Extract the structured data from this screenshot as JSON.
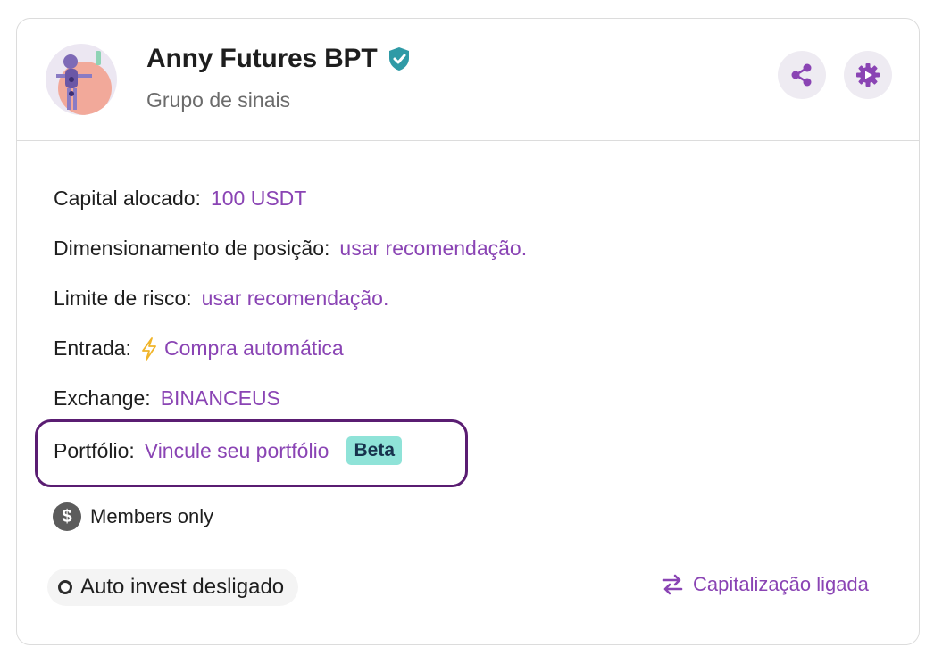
{
  "header": {
    "title": "Anny Futures BPT",
    "subtitle": "Grupo de sinais",
    "avatar_icon": "robot-avatar-icon",
    "verified_icon": "verified-shield-icon",
    "share_icon": "share-icon",
    "settings_icon": "gear-icon"
  },
  "settings": {
    "capital": {
      "label": "Capital alocado:",
      "value": "100 USDT"
    },
    "position_sizing": {
      "label": "Dimensionamento de posição:",
      "value": "usar recomendação."
    },
    "risk_limit": {
      "label": "Limite de risco:",
      "value": "usar recomendação."
    },
    "entry": {
      "label": "Entrada:",
      "icon": "lightning-bolt-icon",
      "value": "Compra automática"
    },
    "exchange": {
      "label": "Exchange:",
      "value": "BINANCEUS"
    },
    "portfolio": {
      "label": "Portfólio:",
      "value": "Vincule seu portfólio",
      "badge": "Beta"
    }
  },
  "members": {
    "icon": "dollar-icon",
    "text": "Members only"
  },
  "footer": {
    "auto_invest": "Auto invest desligado",
    "capitalization": "Capitalização ligada",
    "capitalization_icon": "swap-arrows-icon"
  },
  "colors": {
    "accent": "#8a44b4",
    "highlight_border": "#5a1d72",
    "beta_badge": "#8fe3d8",
    "verified": "#2f9aa6"
  }
}
